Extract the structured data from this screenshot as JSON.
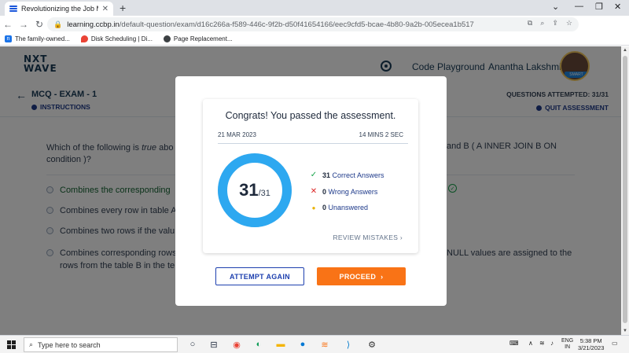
{
  "browser": {
    "tab_title": "Revolutionizing the Job Market |",
    "tab_close": "✕",
    "new_tab": "+",
    "url_host": "learning.ccbp.in",
    "url_path": "/default-question/exam/d16c266a-f589-446c-9f2b-d50f41654166/eec9cfd5-bcae-4b80-9a2b-005ecea1b517",
    "bookmarks": [
      {
        "label": "The family-owned..."
      },
      {
        "label": "Disk Scheduling | Di..."
      },
      {
        "label": "Page Replacement..."
      }
    ]
  },
  "header": {
    "logo_line1": "NXT",
    "logo_line2": "WAVE",
    "code_playground": "Code Playground",
    "user_name": "Anantha Lakshmi",
    "avatar_badge": "SMART"
  },
  "exam": {
    "title": "MCQ - EXAM - 1",
    "instructions": "INSTRUCTIONS",
    "attempted": "QUESTIONS ATTEMPTED: 31/31",
    "quit": "QUIT ASSESSMENT"
  },
  "question": {
    "text_prefix": "Which of the following is",
    "text_em": "true",
    "text_visible_start": "abo",
    "text_right": "and B (",
    "chip_text": "A INNER JOIN B ON",
    "chip_text2": "condition",
    "text_end": ")?",
    "options": [
      {
        "label": "Combines the corresponding"
      },
      {
        "label": "Combines every row in table A"
      },
      {
        "label": "Combines two rows if the valu"
      },
      {
        "label": "Combines corresponding rows"
      }
    ],
    "option4_line2": "rows from the table B in the te",
    "option4_right": "NULL values are assigned to the"
  },
  "modal": {
    "title": "Congrats! You passed the assessment.",
    "date": "21 MAR 2023",
    "duration": "14 MINS 2 SEC",
    "score": 31,
    "total": 31,
    "total_label": "/31",
    "stats": {
      "correct_count": "31",
      "correct_label": "Correct Answers",
      "wrong_count": "0",
      "wrong_label": "Wrong Answers",
      "unanswered_count": "0",
      "unanswered_label": "Unanswered"
    },
    "review": "REVIEW MISTAKES",
    "attempt_again": "ATTEMPT AGAIN",
    "proceed": "PROCEED",
    "ring_color": "#2da8f0"
  },
  "taskbar": {
    "search_placeholder": "Type here to search",
    "lang_line1": "ENG",
    "lang_line2": "IN",
    "time": "5:38 PM",
    "date": "3/21/2023"
  }
}
